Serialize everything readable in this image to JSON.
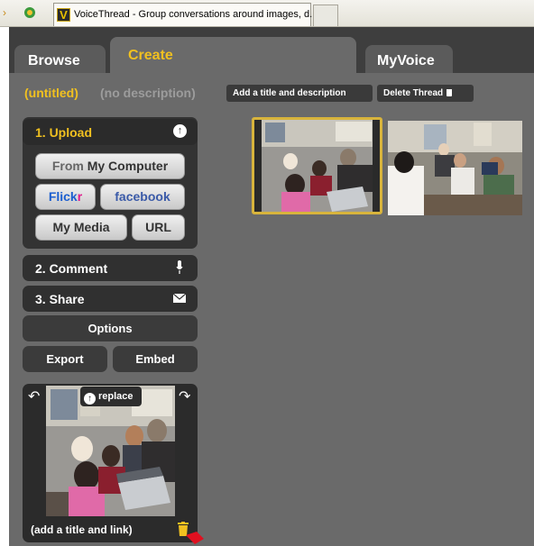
{
  "browser": {
    "tab_title": "VoiceThread - Group conversations around images, d...",
    "favicon_letter": "V"
  },
  "nav": {
    "tabs": [
      {
        "label": "Browse",
        "active": false
      },
      {
        "label": "Create",
        "active": true
      },
      {
        "label": "MyVoice",
        "active": false
      }
    ]
  },
  "thread": {
    "title": "(untitled)",
    "description": "(no description)",
    "add_title_button": "Add a title and description",
    "delete_button": "Delete Thread"
  },
  "steps": {
    "upload": {
      "label": "1. Upload",
      "icon": "upload-icon"
    },
    "comment": {
      "label": "2. Comment",
      "icon": "microphone-icon"
    },
    "share": {
      "label": "3. Share",
      "icon": "envelope-icon"
    }
  },
  "upload_sources": {
    "computer_prefix": "From",
    "computer_label": "My Computer",
    "flickr_a": "Flick",
    "flickr_b": "r",
    "facebook": "facebook",
    "my_media": "My Media",
    "url": "URL"
  },
  "actions": {
    "options": "Options",
    "export": "Export",
    "embed": "Embed"
  },
  "slide_editor": {
    "replace_label": "replace",
    "caption": "(add a title and link)"
  },
  "colors": {
    "accent": "#f0c020",
    "panel_bg": "#333333",
    "app_bg": "#6a6a6a",
    "selected_border": "#d8b43c"
  }
}
